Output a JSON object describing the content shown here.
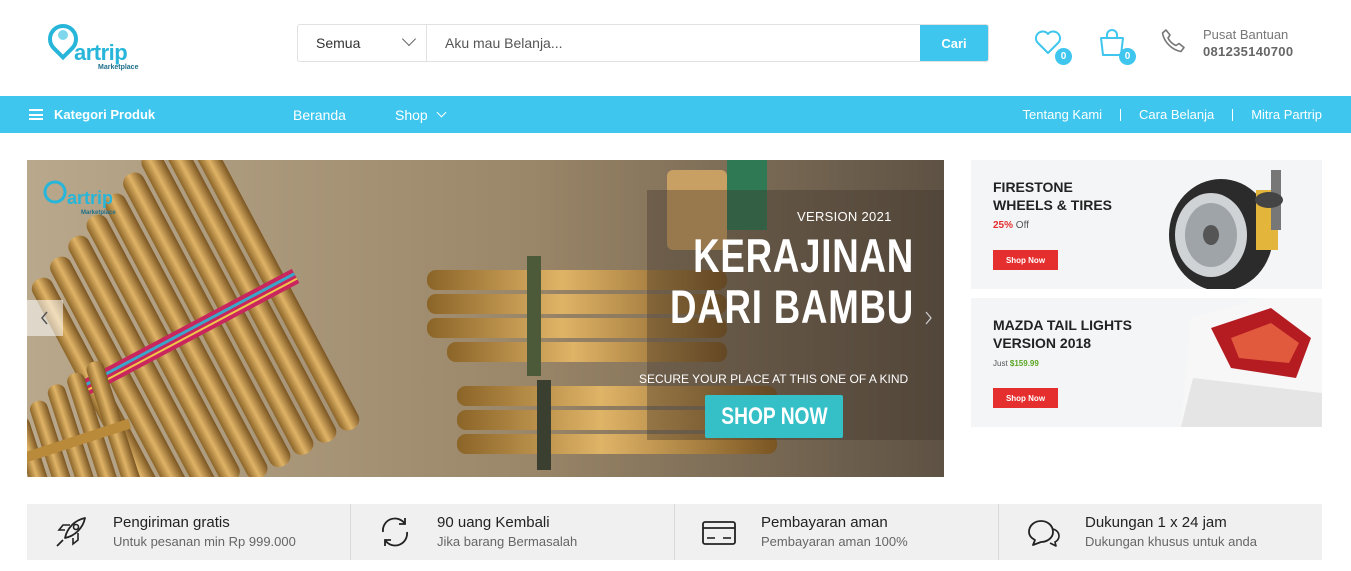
{
  "header": {
    "logo_text": "artrip",
    "logo_sub": "Marketplace",
    "search": {
      "category": "Semua",
      "placeholder": "Aku mau Belanja...",
      "button": "Cari"
    },
    "wishlist_count": "0",
    "cart_count": "0",
    "help": {
      "label": "Pusat Bantuan",
      "phone": "081235140700"
    }
  },
  "nav": {
    "category_label": "Kategori Produk",
    "items": [
      "Beranda",
      "Shop"
    ],
    "right": [
      "Tentang Kami",
      "Cara Belanja",
      "Mitra Partrip"
    ]
  },
  "hero": {
    "version": "VERSION 2021",
    "headline_1": "KERAJINAN",
    "headline_2": "DARI BAMBU",
    "tagline": "SECURE YOUR PLACE AT THIS ONE OF A KIND",
    "cta": "SHOP NOW"
  },
  "banners": [
    {
      "title": "FIRESTONE\nWHEELS & TIRES",
      "discount": "25%",
      "discount_suffix": " Off",
      "cta": "Shop Now"
    },
    {
      "title": "MAZDA TAIL LIGHTS\nVERSION 2018",
      "price_prefix": "Just ",
      "price": "$159.99",
      "cta": "Shop Now"
    }
  ],
  "features": [
    {
      "icon": "rocket-icon",
      "title": "Pengiriman gratis",
      "sub": "Untuk pesanan min Rp 999.000"
    },
    {
      "icon": "refresh-icon",
      "title": "90 uang Kembali",
      "sub": "Jika barang Bermasalah"
    },
    {
      "icon": "credit-card-icon",
      "title": "Pembayaran aman",
      "sub": "Pembayaran aman 100%"
    },
    {
      "icon": "chat-icon",
      "title": "Dukungan 1 x 24 jam",
      "sub": "Dukungan khusus untuk anda"
    }
  ],
  "colors": {
    "accent": "#3ec6ee",
    "sale": "#e52e2e",
    "cta_teal": "#35c0c7"
  }
}
